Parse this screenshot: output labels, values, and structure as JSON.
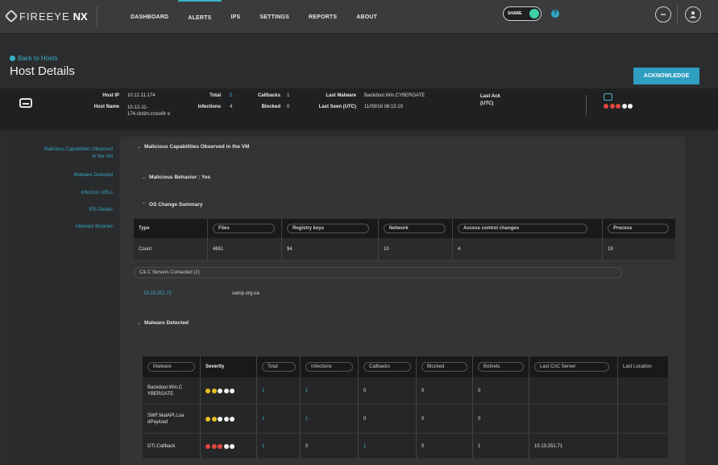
{
  "brand": {
    "name": "FIREEYE",
    "product": "NX"
  },
  "nav": {
    "items": [
      {
        "label": "DASHBOARD",
        "active": false
      },
      {
        "label": "ALERTS",
        "active": true
      },
      {
        "label": "IPS",
        "active": false
      },
      {
        "label": "SETTINGS",
        "active": false
      },
      {
        "label": "REPORTS",
        "active": false
      },
      {
        "label": "ABOUT",
        "active": false
      }
    ],
    "share_label": "SHARE",
    "help_glyph": "?"
  },
  "header": {
    "back_link": "Back to Hosts",
    "title": "Host Details",
    "acknowledge_label": "ACKNOWLEDGE"
  },
  "summary": {
    "host_ip_label": "Host IP",
    "host_ip": "10.12.11.174",
    "host_name_label": "Host Name",
    "host_name": "10-12-11-174.victim.crossfir e",
    "total_label": "Total",
    "total": "5",
    "infections_label": "Infections",
    "infections": "4",
    "callbacks_label": "Callbacks",
    "callbacks": "1",
    "blocked_label": "Blocked",
    "blocked": "0",
    "last_malware_label": "Last Malware",
    "last_malware": "Backdoor.Win.CYBERGATE",
    "last_seen_label": "Last Seen (UTC)",
    "last_seen": "11/09/18 08:15:19",
    "last_ack_label": "Last Ack (UTC)",
    "severity_colors": [
      "#e0463f",
      "#e0463f",
      "#e0463f",
      "#f2f2f2",
      "#f2f2f2"
    ]
  },
  "sidebar": {
    "items": [
      "Malicious Capabilities Observed in the VM",
      "Malware Detected",
      "Infection URLs",
      "IPS Details",
      "Malware Binaries"
    ]
  },
  "sections": {
    "malicious_capabilities": "Malicious Capabilities Observed in the VM",
    "malicious_behavior": "Malicious Behavior : Yes",
    "os_change_summary": "OS Change Summary",
    "malware_detected": "Malware Detected"
  },
  "os_table": {
    "headers": [
      "Type",
      "Files",
      "Registry keys",
      "Network",
      "Access control changes",
      "Process"
    ],
    "row": [
      "Count",
      "4651",
      "94",
      "10",
      "4",
      "19"
    ]
  },
  "cnc": {
    "header": "C& C Servers Contacted (2)",
    "ip": "10.13.251.71",
    "domain": "uamp.org.ua"
  },
  "malware_table": {
    "headers": [
      "Malware",
      "Severity",
      "Total",
      "Infections",
      "Callbacks",
      "Blocked",
      "Botnets",
      "Last CnC Server",
      "Last Location"
    ],
    "rows": [
      {
        "name": "Backdoor.Win.C YBERGATE",
        "severity": [
          "#e8c21d",
          "#e8c21d",
          "#f2f2f2",
          "#f2f2f2",
          "#f2f2f2"
        ],
        "total": "1",
        "infections": "1",
        "callbacks": "0",
        "blocked": "0",
        "botnets": "0",
        "last_cnc": "",
        "last_location": ""
      },
      {
        "name": "SWF.MalAPI.Loa dPayload",
        "severity": [
          "#e8c21d",
          "#e8c21d",
          "#f2f2f2",
          "#f2f2f2",
          "#f2f2f2"
        ],
        "total": "1",
        "infections": "1",
        "callbacks": "0",
        "blocked": "0",
        "botnets": "0",
        "last_cnc": "",
        "last_location": ""
      },
      {
        "name": "DTI.Callback",
        "severity": [
          "#e0463f",
          "#e0463f",
          "#e0463f",
          "#f2f2f2",
          "#f2f2f2"
        ],
        "total": "1",
        "infections": "0",
        "callbacks": "1",
        "blocked": "0",
        "botnets": "1",
        "last_cnc": "10.13.251.71",
        "last_location": ""
      }
    ]
  }
}
